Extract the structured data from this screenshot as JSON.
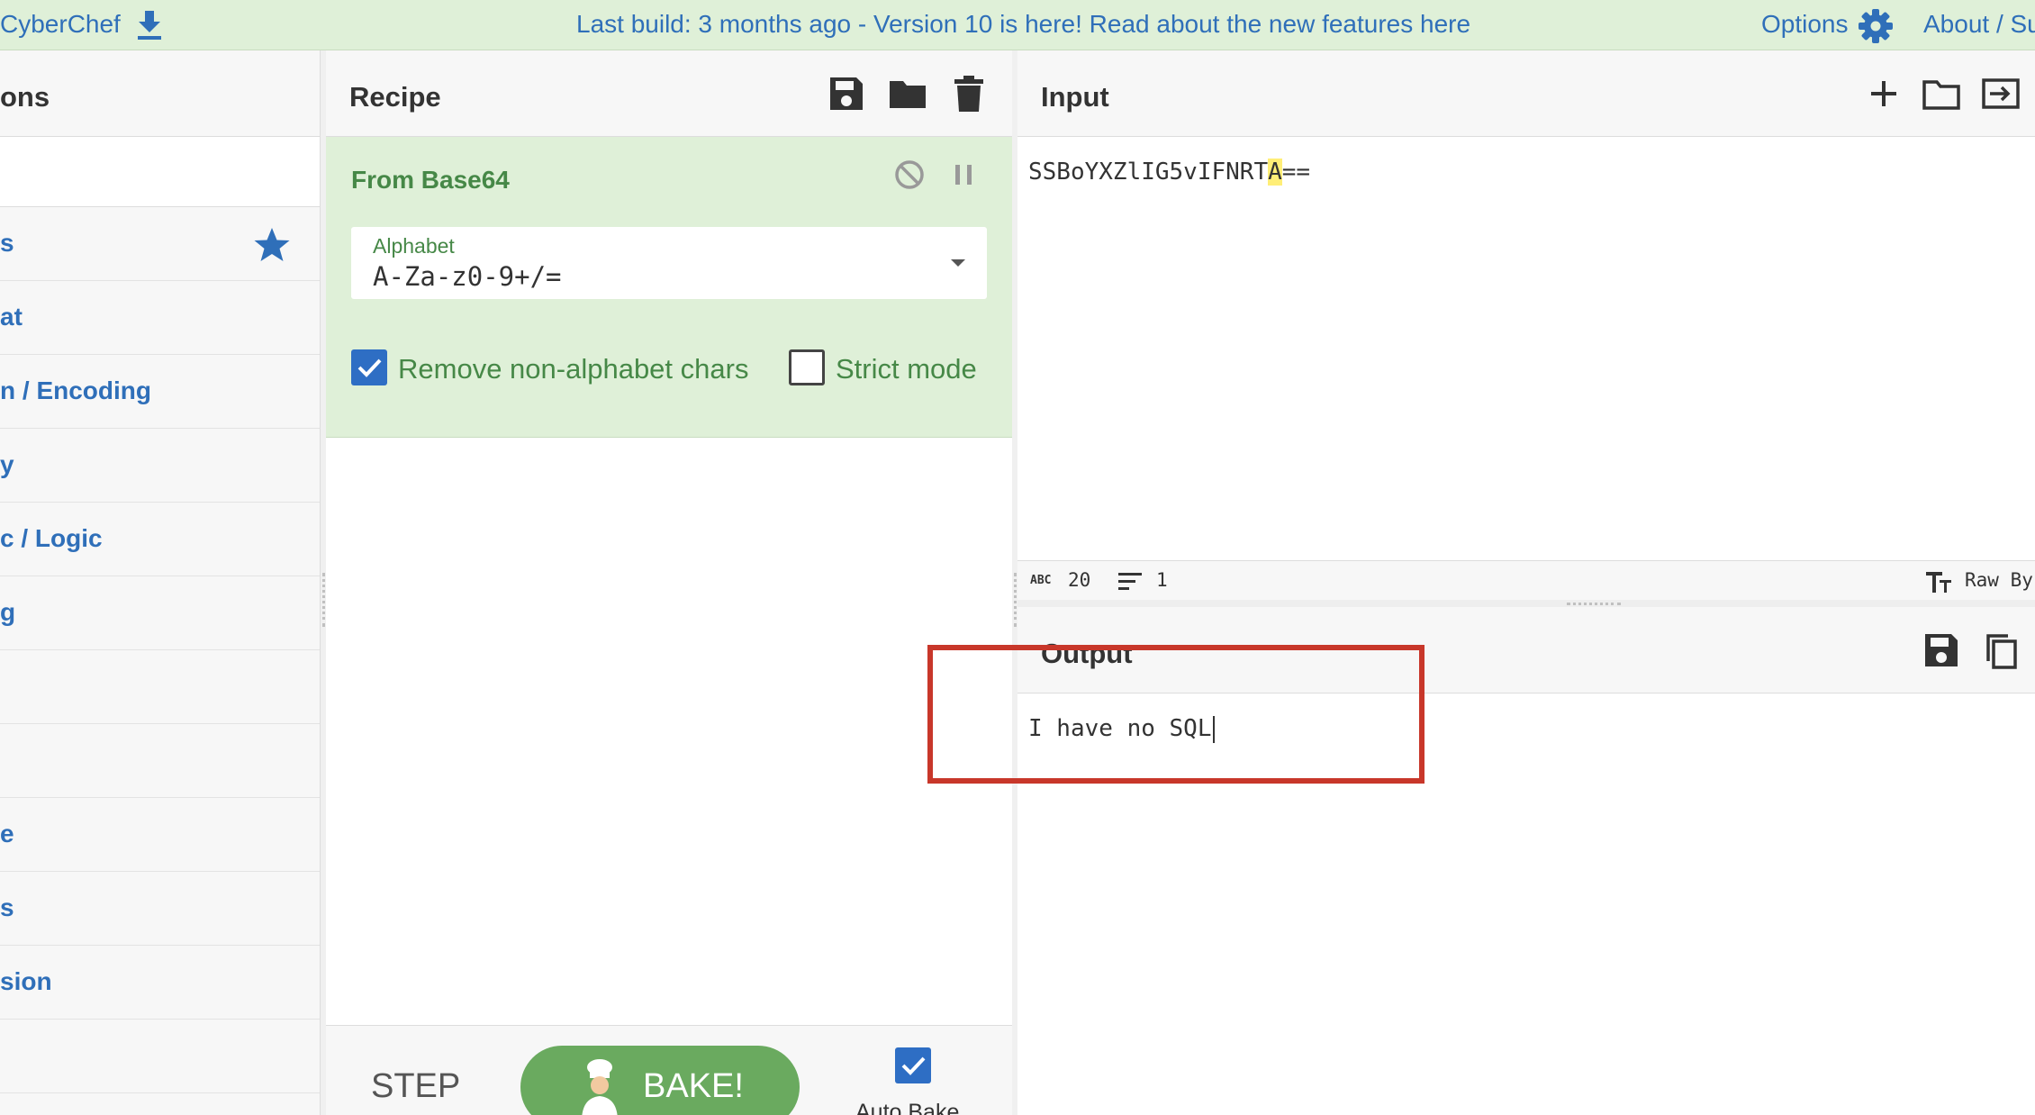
{
  "banner": {
    "brand": "CyberChef",
    "notice": "Last build: 3 months ago - Version 10 is here! Read about the new features here",
    "options_label": "Options",
    "about_label": "About / Su"
  },
  "operations": {
    "title": "ons",
    "categories": [
      {
        "label": "s",
        "favourite": true
      },
      {
        "label": "at"
      },
      {
        "label": "n / Encoding"
      },
      {
        "label": "y"
      },
      {
        "label": "c / Logic"
      },
      {
        "label": "g"
      },
      {
        "label": ""
      },
      {
        "label": ""
      },
      {
        "label": "e"
      },
      {
        "label": "s"
      },
      {
        "label": "sion"
      },
      {
        "label": ""
      }
    ]
  },
  "recipe": {
    "title": "Recipe",
    "operation": {
      "name": "From Base64",
      "alphabet_label": "Alphabet",
      "alphabet_value": "A-Za-z0-9+/=",
      "remove_non_alphabet_label": "Remove non-alphabet chars",
      "remove_non_alphabet_checked": true,
      "strict_mode_label": "Strict mode",
      "strict_mode_checked": false
    },
    "step_label": "STEP",
    "bake_label": "BAKE!",
    "auto_bake_label": "Auto Bake",
    "auto_bake_checked": true
  },
  "input": {
    "title": "Input",
    "text_before": "SSBoYXZlIG5vIFNRT",
    "text_highlight": "A",
    "text_after": "==",
    "length": "20",
    "lines": "1",
    "encoding": "Raw By"
  },
  "output": {
    "title": "Output",
    "text": "I have no SQL"
  },
  "colors": {
    "banner_bg": "#dff0d8",
    "accent_blue": "#2f6fb9",
    "op_green": "#468847",
    "bake_green": "#6aaa5f",
    "highlight_box": "#c8372a"
  }
}
